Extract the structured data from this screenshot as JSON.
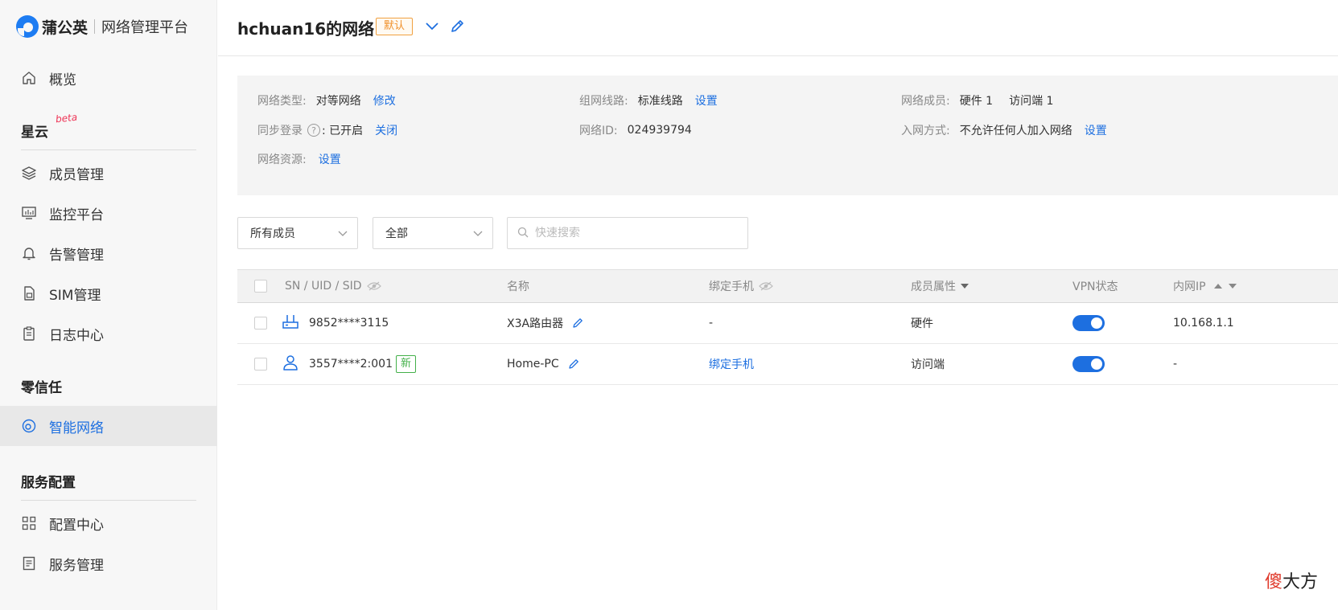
{
  "app": {
    "brand": "蒲公英",
    "subtitle": "网络管理平台"
  },
  "sidebar": {
    "overview": "概览",
    "section_xingyun": "星云",
    "beta": "beta",
    "items_xingyun": [
      "成员管理",
      "监控平台",
      "告警管理",
      "SIM管理",
      "日志中心"
    ],
    "section_zero_trust": "零信任",
    "smart_network": "智能网络",
    "section_service": "服务配置",
    "items_service": [
      "配置中心",
      "服务管理"
    ]
  },
  "header": {
    "network_name": "hchuan16的网络",
    "default_tag": "默认"
  },
  "info": {
    "network_type_label": "网络类型:",
    "network_type_value": "对等网络",
    "network_type_action": "修改",
    "sync_login_label": "同步登录",
    "sync_login_value": ": 已开启",
    "sync_login_action": "关闭",
    "resources_label": "网络资源:",
    "resources_action": "设置",
    "line_label": "组网线路:",
    "line_value": "标准线路",
    "line_action": "设置",
    "network_id_label": "网络ID:",
    "network_id_value": "024939794",
    "members_label": "网络成员:",
    "members_hardware": "硬件 1",
    "members_client": "访问端 1",
    "join_label": "入网方式:",
    "join_value": "不允许任何人加入网络",
    "join_action": "设置"
  },
  "filters": {
    "member_select": "所有成员",
    "type_select": "全部",
    "search_placeholder": "快速搜索"
  },
  "table": {
    "columns": {
      "sn": "SN / UID / SID",
      "name": "名称",
      "phone": "绑定手机",
      "attr": "成员属性",
      "vpn": "VPN状态",
      "ip": "内网IP"
    },
    "rows": [
      {
        "id": "9852****3115",
        "name": "X3A路由器",
        "phone": "-",
        "attr": "硬件",
        "vpn_on": true,
        "ip": "10.168.1.1",
        "icon": "router-icon"
      },
      {
        "id": "3557****2:001",
        "badge": "新",
        "name": "Home-PC",
        "phone": "绑定手机",
        "attr": "访问端",
        "vpn_on": true,
        "ip": "-",
        "icon": "user-icon"
      }
    ]
  },
  "watermark": {
    "red": "傻",
    "black": "大方"
  },
  "colors": {
    "accent": "#1d6fe0",
    "default_tag": "#f0902a",
    "new_badge": "#43b049",
    "watermark_red": "#e03a2c"
  }
}
